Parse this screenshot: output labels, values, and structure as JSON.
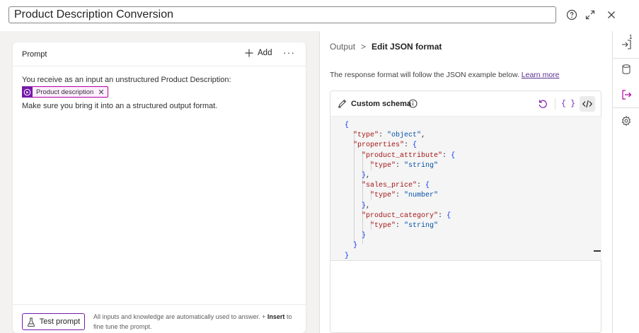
{
  "header": {
    "title": "Product Description Conversion",
    "icons": [
      "help-icon",
      "expand-icon",
      "close-icon"
    ]
  },
  "prompt": {
    "title": "Prompt",
    "add_label": "Add",
    "more_label": "···",
    "line1": "You receive as an input an unstructured Product Description:",
    "chip_label": "Product description",
    "line2": "Make sure you bring it into an a structured output format.",
    "test_button_label": "Test prompt",
    "footer_note_part1": "All inputs and knowledge are automatically used to answer. +",
    "footer_note_bold": "Insert",
    "footer_note_part2": "to fine tune the prompt."
  },
  "output": {
    "breadcrumb_parent": "Output",
    "breadcrumb_separator": ">",
    "breadcrumb_current": "Edit JSON format",
    "response_text": "The response format will follow the JSON example below.",
    "learn_more_label": "Learn more",
    "schema_title": "Custom schema",
    "code_lines": [
      "{",
      "  \"type\": \"object\",",
      "  \"properties\": {",
      "    \"product_attribute\": {",
      "      \"type\": \"string\"",
      "    },",
      "    \"sales_price\": {",
      "      \"type\": \"number\"",
      "    },",
      "    \"product_category\": {",
      "      \"type\": \"string\"",
      "    }",
      "  }",
      "}"
    ]
  },
  "rail": {
    "badge_count": "1",
    "icons": [
      "input-icon",
      "database-icon",
      "output-icon",
      "settings-icon"
    ]
  },
  "colors": {
    "accent": "#7719aa",
    "chip_border": "#b4009e",
    "json_key": "#a31515",
    "json_string": "#0451a5"
  }
}
